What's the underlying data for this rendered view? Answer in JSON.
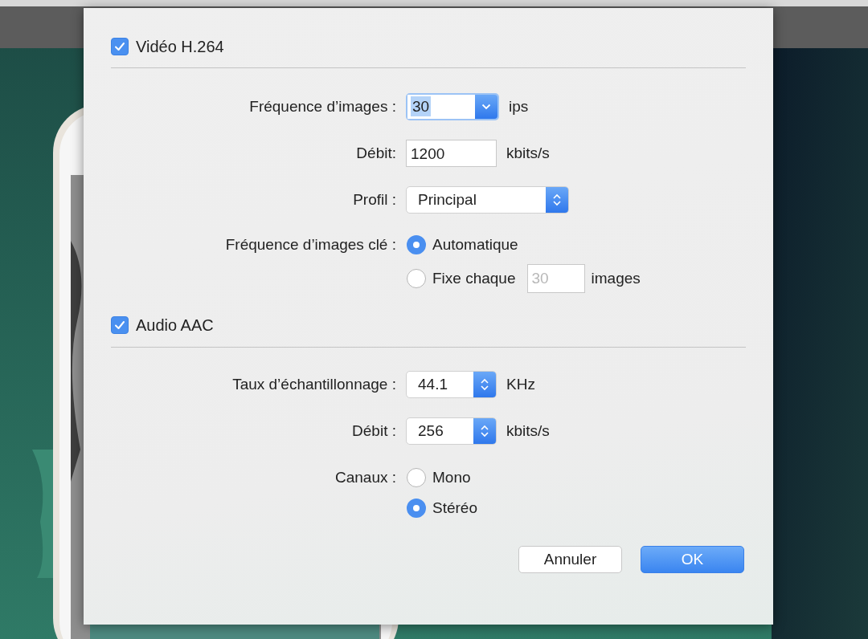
{
  "sections": [
    {
      "kind": "video",
      "title": "Vidéo H.264",
      "checked": true,
      "rows": [
        {
          "kind": "combo",
          "label": "Fréquence d’images :",
          "value": "30",
          "focused": true,
          "unit": "ips"
        },
        {
          "kind": "text",
          "label": "Débit:",
          "value": "1200",
          "unit": "kbits/s"
        },
        {
          "kind": "popup",
          "label": "Profil :",
          "value": "Principal"
        },
        {
          "kind": "radios",
          "label": "Fréquence d’images clé :",
          "options": [
            {
              "label": "Automatique",
              "selected": true
            },
            {
              "label": "Fixe chaque",
              "selected": false,
              "field": {
                "value": "30",
                "disabled": true
              },
              "unit": "images"
            }
          ]
        }
      ]
    },
    {
      "kind": "audio",
      "title": "Audio AAC",
      "checked": true,
      "rows": [
        {
          "kind": "popup",
          "label": "Taux d’échantillonnage :",
          "value": "44.1",
          "unit": "KHz"
        },
        {
          "kind": "popup",
          "label": "Débit :",
          "value": "256",
          "unit": "kbits/s"
        },
        {
          "kind": "radios",
          "label": "Canaux :",
          "options": [
            {
              "label": "Mono",
              "selected": false
            },
            {
              "label": "Stéréo",
              "selected": true
            }
          ]
        }
      ]
    }
  ],
  "buttons": [
    {
      "label": "Annuler",
      "default": false
    },
    {
      "label": "OK",
      "default": true
    }
  ]
}
